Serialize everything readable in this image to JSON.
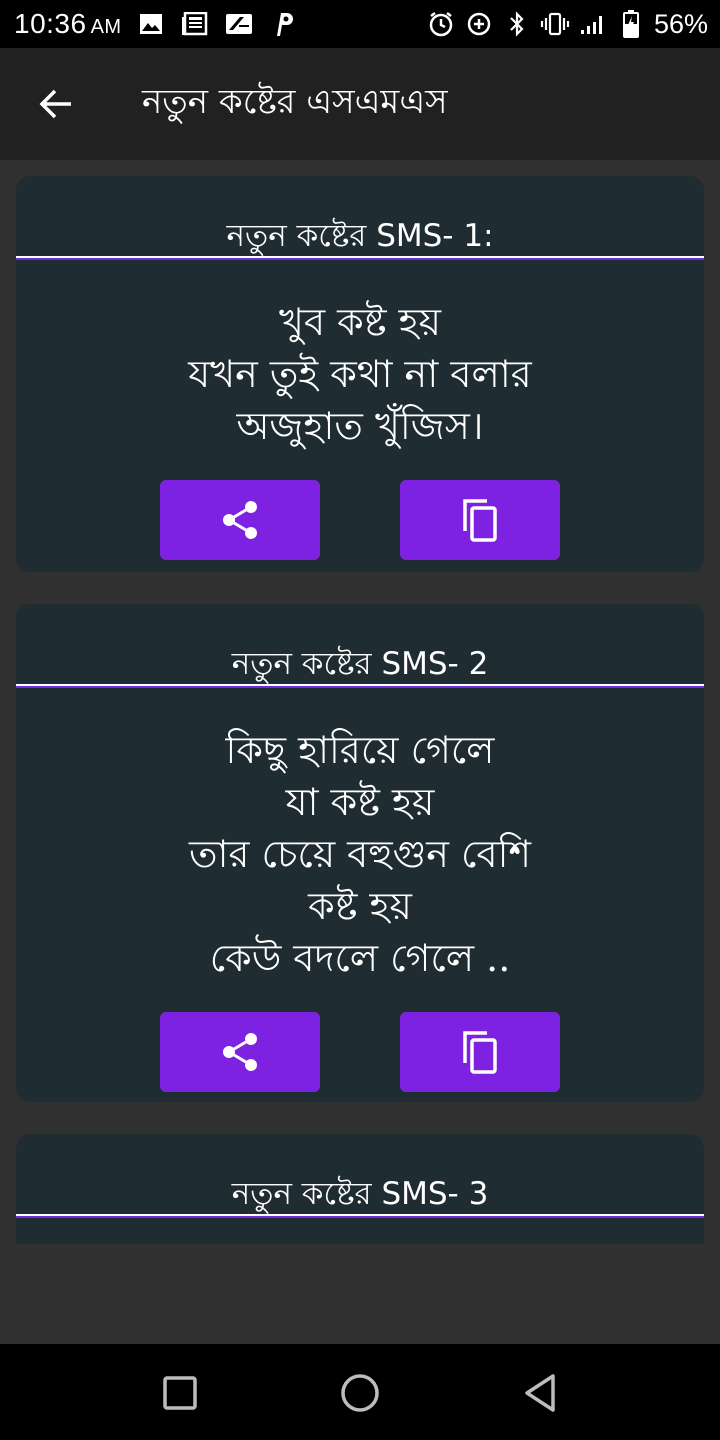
{
  "status_bar": {
    "time": "10:36",
    "ampm": "AM",
    "battery": "56%"
  },
  "app_bar": {
    "title": "নতুন কষ্টের এসএমএস"
  },
  "cards": [
    {
      "title": "নতুন কষ্টের SMS- 1:",
      "lines": [
        "খুব কষ্ট হয়",
        "যখন তুই কথা না বলার",
        "অজুহাত খুঁজিস।"
      ]
    },
    {
      "title": "নতুন কষ্টের SMS- 2",
      "lines": [
        "কিছু হারিয়ে গেলে",
        "যা কষ্ট হয়",
        "তার চেয়ে বহুগুন বেশি",
        "কষ্ট হয়",
        "কেউ বদলে গেলে .."
      ]
    },
    {
      "title": "নতুন কষ্টের SMS- 3",
      "lines": []
    }
  ],
  "colors": {
    "accent": "#7c22e0",
    "card_bg": "#1f2d33",
    "app_bar_bg": "#212121",
    "page_bg": "#303030"
  }
}
